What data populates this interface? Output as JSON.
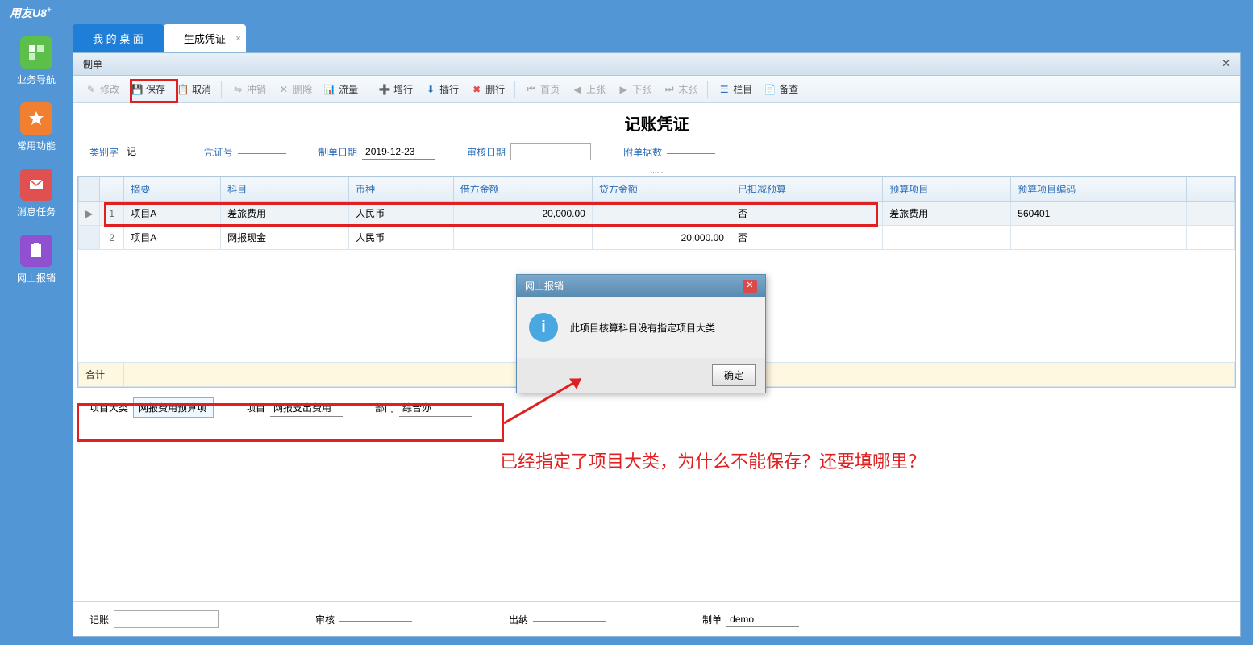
{
  "app": {
    "title": "用友U8",
    "title_sup": "+"
  },
  "sidebar": {
    "items": [
      {
        "label": "业务导航",
        "bg": "#5BBF4A"
      },
      {
        "label": "常用功能",
        "bg": "#F08030"
      },
      {
        "label": "消息任务",
        "bg": "#E05050"
      },
      {
        "label": "网上报销",
        "bg": "#9050D0"
      }
    ]
  },
  "tabs": [
    {
      "label": "我 的 桌 面",
      "active": true
    },
    {
      "label": "生成凭证",
      "close": "×"
    }
  ],
  "panel": {
    "title": "制单",
    "close": "✕"
  },
  "toolbar": {
    "edit": "修改",
    "save": "保存",
    "cancel": "取消",
    "reverse": "冲销",
    "delete": "删除",
    "flow": "流量",
    "addrow": "增行",
    "insrow": "插行",
    "delrow": "删行",
    "first": "首页",
    "prev": "上张",
    "next": "下张",
    "last": "末张",
    "column": "栏目",
    "audit": "备查"
  },
  "doc": {
    "title": "记账凭证",
    "category_label": "类别字",
    "category_value": "记",
    "voucher_label": "凭证号",
    "voucher_value": "",
    "date_label": "制单日期",
    "date_value": "2019-12-23",
    "audit_date_label": "审核日期",
    "audit_date_value": "",
    "attach_label": "附单据数",
    "attach_value": ""
  },
  "grid": {
    "headers": {
      "summary": "摘要",
      "account": "科目",
      "currency": "币种",
      "debit": "借方金额",
      "credit": "贷方金额",
      "deducted": "已扣减预算",
      "budget_item": "预算项目",
      "budget_code": "预算项目编码"
    },
    "rows": [
      {
        "num": "1",
        "summary": "项目A",
        "account": "差旅费用",
        "currency": "人民币",
        "debit": "20,000.00",
        "credit": "",
        "deducted": "否",
        "budget_item": "差旅费用",
        "budget_code": "560401"
      },
      {
        "num": "2",
        "summary": "项目A",
        "account": "网报现金",
        "currency": "人民币",
        "debit": "",
        "credit": "20,000.00",
        "deducted": "否",
        "budget_item": "",
        "budget_code": ""
      }
    ],
    "total_label": "合计"
  },
  "footer": {
    "category_label": "项目大类",
    "category_value": "网报费用预算项",
    "project_label": "项目",
    "project_value": "网报支出费用",
    "dept_label": "部门",
    "dept_value": "综合办"
  },
  "bottom": {
    "book_label": "记账",
    "book_value": "",
    "audit_label": "审核",
    "audit_value": "",
    "cashier_label": "出纳",
    "cashier_value": "",
    "maker_label": "制单",
    "maker_value": "demo"
  },
  "dialog": {
    "title": "网上报销",
    "message": "此项目核算科目没有指定项目大类",
    "ok": "确定"
  },
  "annotation": {
    "text": "已经指定了项目大类，为什么不能保存？还要填哪里？"
  }
}
